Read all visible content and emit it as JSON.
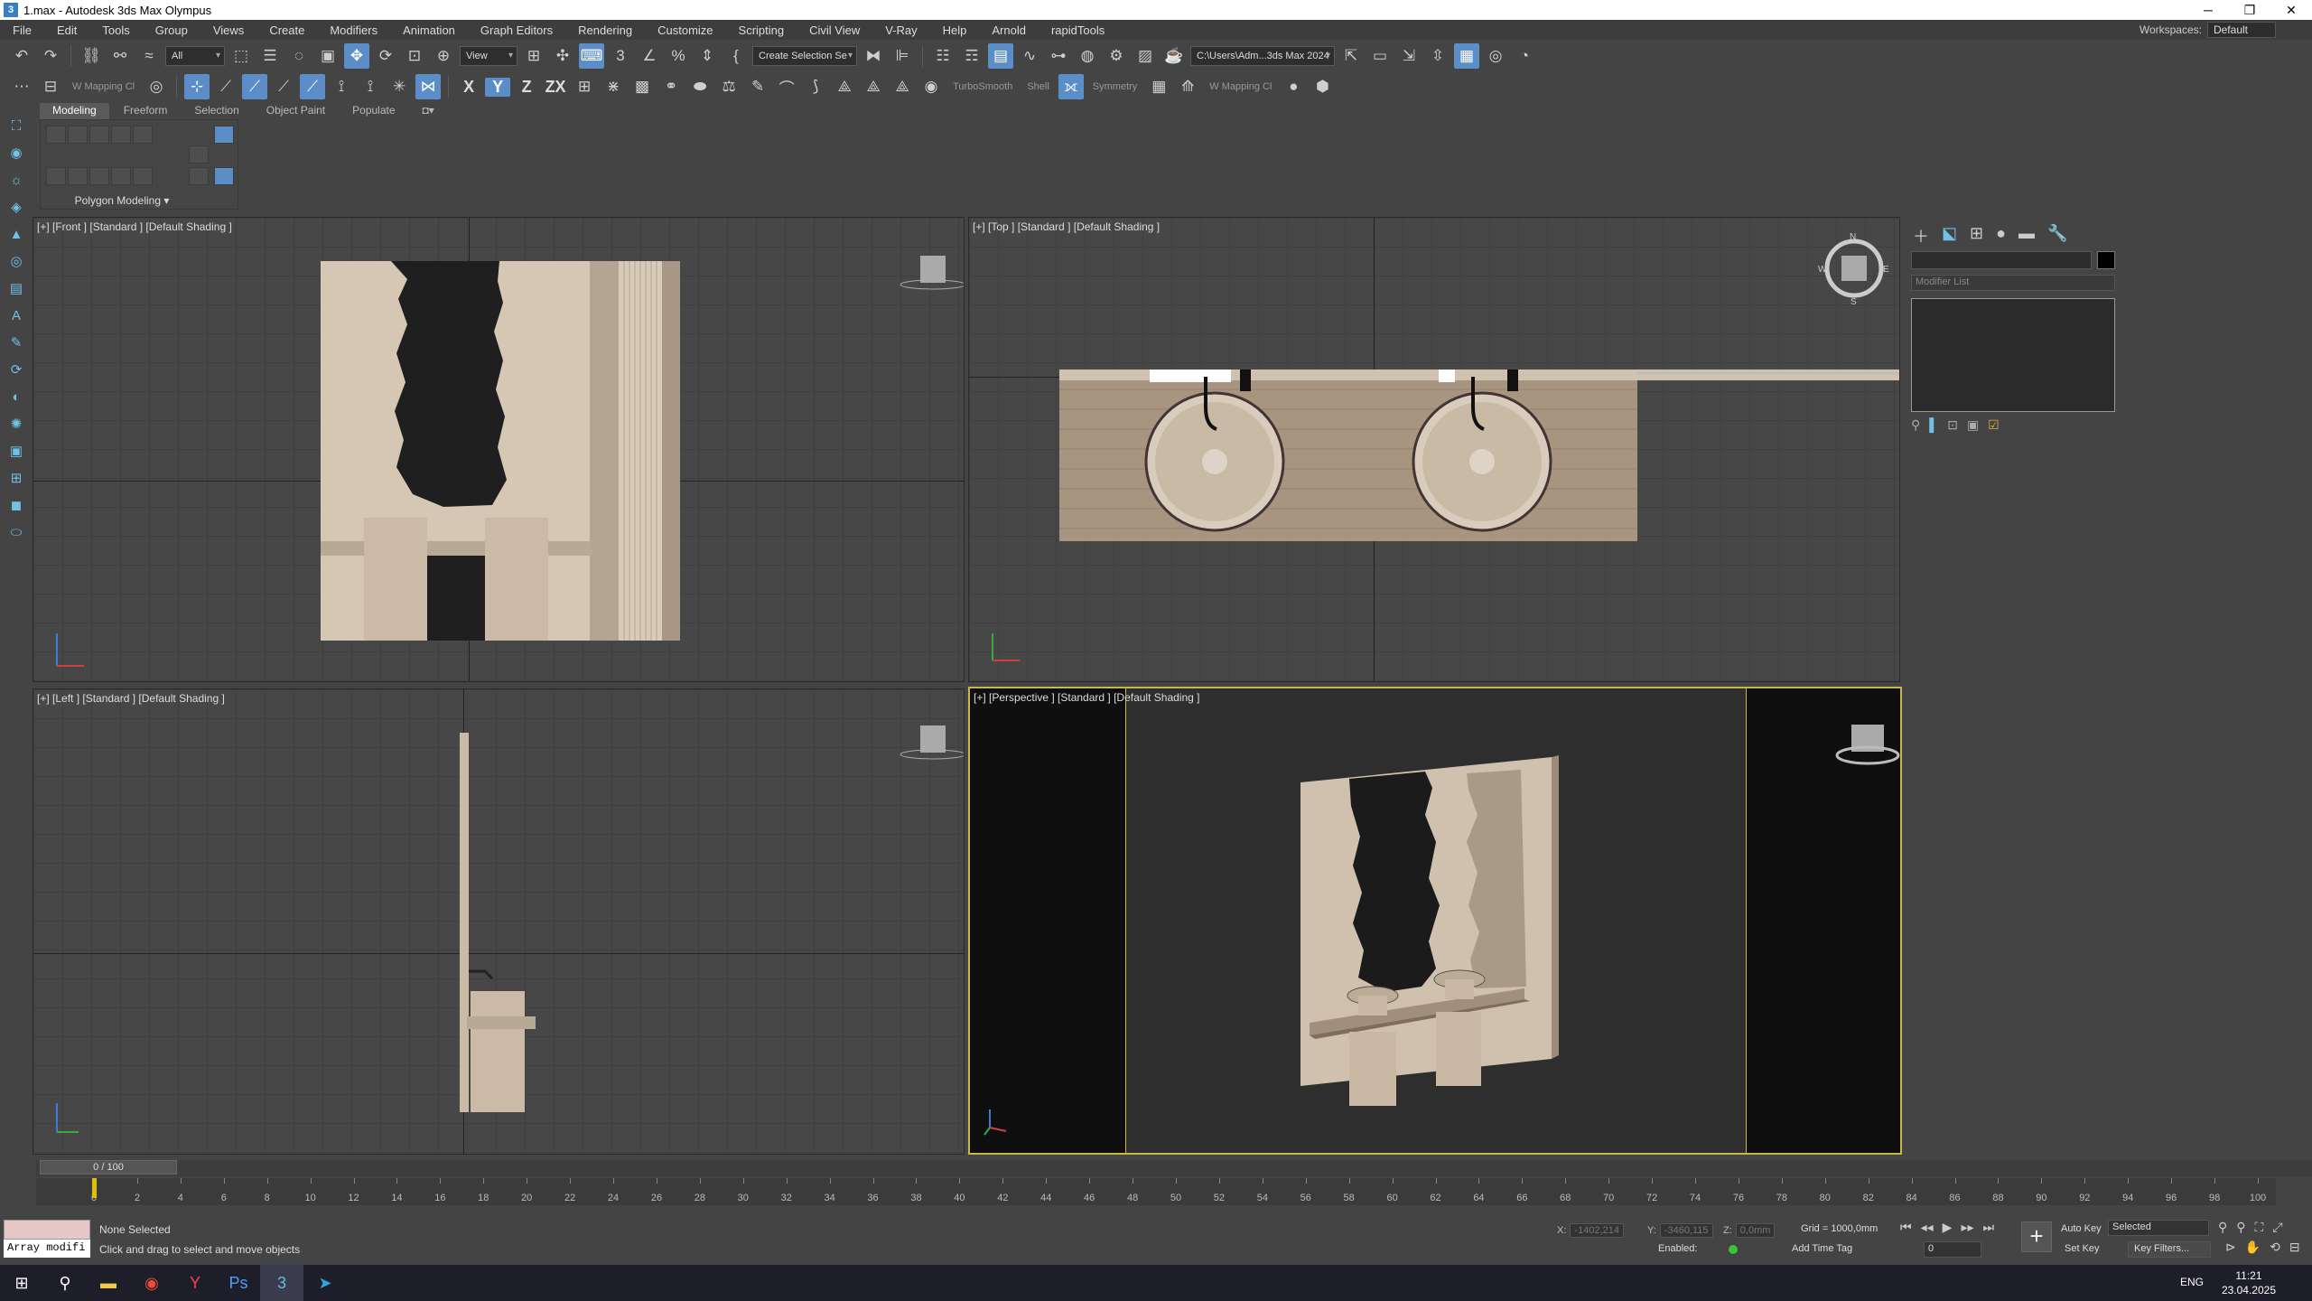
{
  "window": {
    "title": "1.max - Autodesk 3ds Max Olympus",
    "app_icon": "3"
  },
  "menu": [
    "File",
    "Edit",
    "Tools",
    "Group",
    "Views",
    "Create",
    "Modifiers",
    "Animation",
    "Graph Editors",
    "Rendering",
    "Customize",
    "Scripting",
    "Civil View",
    "V-Ray",
    "Help",
    "Arnold",
    "rapidTools"
  ],
  "workspaces": {
    "label": "Workspaces:",
    "value": "Default"
  },
  "toolbar1": {
    "filter": "All",
    "ref_coord": "View",
    "named_selection": "Create Selection Se",
    "project_path": "C:\\Users\\Adm...3ds Max 2024"
  },
  "toolbar2": {
    "uvw_map_1": "W Mapping Cl",
    "turbosmooth": "TurboSmooth",
    "shell": "Shell",
    "symmetry": "Symmetry",
    "uvw_map_2": "W Mapping Cl",
    "axis_x": "X",
    "axis_y": "Y",
    "axis_z": "Z",
    "axis_zx": "ZX"
  },
  "ribbon": {
    "tabs": [
      "Modeling",
      "Freeform",
      "Selection",
      "Object Paint",
      "Populate"
    ],
    "active_tab": "Modeling",
    "panel_label": "Polygon Modeling ▾"
  },
  "viewports": {
    "front": "[+] [Front ] [Standard ] [Default Shading ]",
    "top": "[+] [Top ] [Standard ] [Default Shading ]",
    "left": "[+] [Left ] [Standard ] [Default Shading ]",
    "perspective": "[+] [Perspective ] [Standard ] [Default Shading ]"
  },
  "compass": {
    "n": "N",
    "s": "S",
    "e": "E",
    "w": "W"
  },
  "command_panel": {
    "modifier_list": "Modifier List"
  },
  "timeline": {
    "slider": "0 / 100",
    "ticks": [
      "0",
      "2",
      "4",
      "6",
      "8",
      "10",
      "12",
      "14",
      "16",
      "18",
      "20",
      "22",
      "24",
      "26",
      "28",
      "30",
      "32",
      "34",
      "36",
      "38",
      "40",
      "42",
      "44",
      "46",
      "48",
      "50",
      "52",
      "54",
      "56",
      "58",
      "60",
      "62",
      "64",
      "66",
      "68",
      "70",
      "72",
      "74",
      "76",
      "78",
      "80",
      "82",
      "84",
      "86",
      "88",
      "90",
      "92",
      "94",
      "96",
      "98",
      "100"
    ]
  },
  "status": {
    "maxscript": "Array modifi",
    "selection": "None Selected",
    "prompt": "Click and drag to select and move objects",
    "x_label": "X:",
    "x": "-1402,214",
    "y_label": "Y:",
    "y": "-3460,115",
    "z_label": "Z:",
    "z": "0,0mm",
    "grid": "Grid = 1000,0mm",
    "enabled": "Enabled:",
    "add_time_tag": "Add Time Tag",
    "frame": "0",
    "auto_key": "Auto Key",
    "set_key": "Set Key",
    "selected": "Selected",
    "key_filters": "Key Filters..."
  },
  "taskbar": {
    "lang": "ENG",
    "time": "11:21",
    "date": "23.04.2025"
  },
  "colors": {
    "accent": "#5b8dc8",
    "active_viewport": "#c8b84a",
    "stone": "#c9b9a4",
    "wood": "#a89580"
  }
}
